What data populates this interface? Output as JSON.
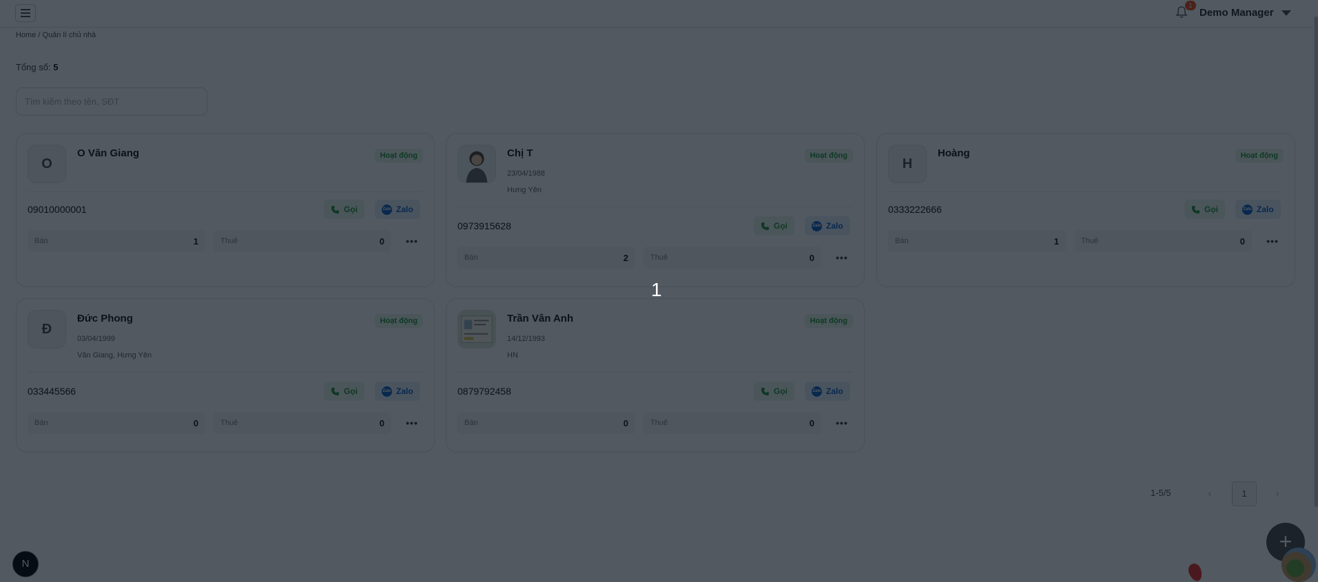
{
  "header": {
    "user_name": "Demo Manager",
    "notification_count": "1"
  },
  "breadcrumb": "Home / Quản lí chủ nhà",
  "summary": {
    "label": "Tổng số:",
    "count": "5"
  },
  "search": {
    "placeholder": "Tìm kiếm theo tên, SĐT"
  },
  "labels": {
    "call": "Gọi",
    "zalo": "Zalo",
    "sell": "Bán",
    "rent": "Thuê",
    "zalo_icon": "Zalo",
    "more": "•••"
  },
  "cards": [
    {
      "name": "O Văn Giang",
      "initial": "O",
      "status": "Hoạt động",
      "dob": "",
      "address": "",
      "phone": "09010000001",
      "sell": "1",
      "rent": "0",
      "avatar_type": "initial"
    },
    {
      "name": "Chị T",
      "initial": "",
      "status": "Hoạt động",
      "dob": "23/04/1988",
      "address": "Hưng Yên",
      "phone": "0973915628",
      "sell": "2",
      "rent": "0",
      "avatar_type": "portrait"
    },
    {
      "name": "Hoàng",
      "initial": "H",
      "status": "Hoạt động",
      "dob": "",
      "address": "",
      "phone": "0333222666",
      "sell": "1",
      "rent": "0",
      "avatar_type": "initial"
    },
    {
      "name": "Đức Phong",
      "initial": "Đ",
      "status": "Hoạt động",
      "dob": "03/04/1999",
      "address": "Văn Giang, Hưng Yên",
      "phone": "033445566",
      "sell": "0",
      "rent": "0",
      "avatar_type": "initial"
    },
    {
      "name": "Trần Vân Anh",
      "initial": "",
      "status": "Hoạt động",
      "dob": "14/12/1993",
      "address": "HN",
      "phone": "0879792458",
      "sell": "0",
      "rent": "0",
      "avatar_type": "document"
    }
  ],
  "pagination": {
    "range": "1-5/5",
    "current_page": "1",
    "prev": "‹",
    "next": "›"
  },
  "overlay_number": "1",
  "fab": {
    "label": "+"
  },
  "corner_badge": "N",
  "colors": {
    "status_green": "#2f9a44",
    "zalo_blue": "#1a68c7",
    "overlay": "#000a14"
  },
  "icons": [
    "menu-icon",
    "bell-icon",
    "caret-down-icon",
    "phone-icon",
    "zalo-icon",
    "more-icon",
    "plus-icon"
  ]
}
